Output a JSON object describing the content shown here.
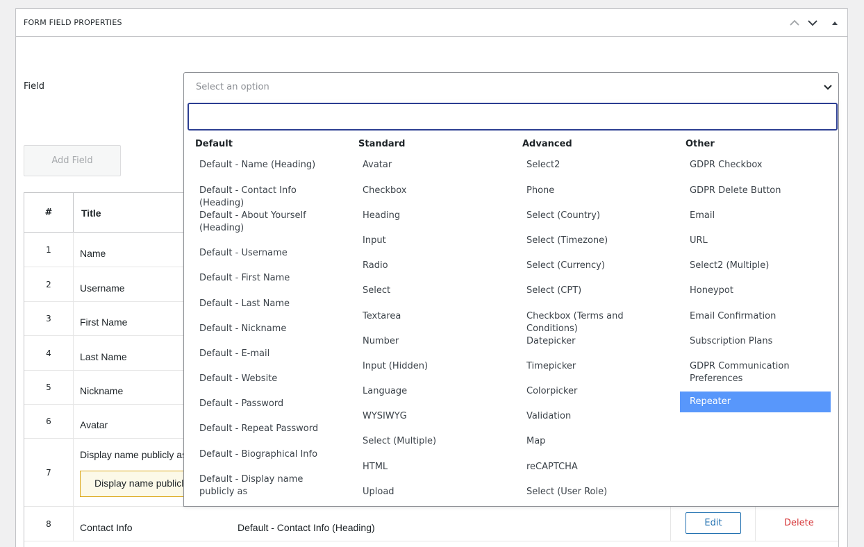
{
  "panel": {
    "title": "FORM FIELD PROPERTIES",
    "icons": [
      "chevron-up-icon",
      "chevron-down-icon",
      "triangle-up-icon"
    ]
  },
  "field": {
    "label": "Field",
    "placeholder": "Select an option"
  },
  "add_field_label": "Add Field",
  "table": {
    "headers": {
      "num": "#",
      "title": "Title"
    },
    "rows": [
      {
        "num": "1",
        "title": "Name"
      },
      {
        "num": "2",
        "title": "Username"
      },
      {
        "num": "3",
        "title": "First Name"
      },
      {
        "num": "4",
        "title": "Last Name"
      },
      {
        "num": "5",
        "title": "Nickname"
      },
      {
        "num": "6",
        "title": "Avatar"
      },
      {
        "num": "7",
        "title": "Display name publicly as",
        "notice": "Display name publicly as"
      },
      {
        "num": "8",
        "title": "Contact Info",
        "type": "Default - Contact Info (Heading)",
        "edit": "Edit",
        "delete": "Delete"
      }
    ]
  },
  "dropdown": {
    "groups": [
      {
        "title": "Default",
        "options": [
          "Default - Name (Heading)",
          "Default - Contact Info (Heading)",
          "Default - About Yourself (Heading)",
          "Default - Username",
          "Default - First Name",
          "Default - Last Name",
          "Default - Nickname",
          "Default - E-mail",
          "Default - Website",
          "Default - Password",
          "Default - Repeat Password",
          "Default - Biographical Info",
          "Default - Display name publicly as"
        ]
      },
      {
        "title": "Standard",
        "options": [
          "Avatar",
          "Checkbox",
          "Heading",
          "Input",
          "Radio",
          "Select",
          "Textarea",
          "Number",
          "Input (Hidden)",
          "Language",
          "WYSIWYG",
          "Select (Multiple)",
          "HTML",
          "Upload"
        ]
      },
      {
        "title": "Advanced",
        "options": [
          "Select2",
          "Phone",
          "Select (Country)",
          "Select (Timezone)",
          "Select (Currency)",
          "Select (CPT)",
          "Checkbox (Terms and Conditions)",
          "Datepicker",
          "Timepicker",
          "Colorpicker",
          "Validation",
          "Map",
          "reCAPTCHA",
          "Select (User Role)"
        ]
      },
      {
        "title": "Other",
        "options": [
          "GDPR Checkbox",
          "GDPR Delete Button",
          "Email",
          "URL",
          "Select2 (Multiple)",
          "Honeypot",
          "Email Confirmation",
          "Subscription Plans",
          "GDPR Communication Preferences",
          "Repeater"
        ],
        "highlighted": "Repeater"
      }
    ]
  },
  "colors": {
    "highlight": "#5897fb",
    "search_border": "#2c3e92",
    "edit": "#2271b1",
    "delete": "#d63638",
    "notice_bg": "#fcf9e8",
    "notice_border": "#dba617"
  }
}
